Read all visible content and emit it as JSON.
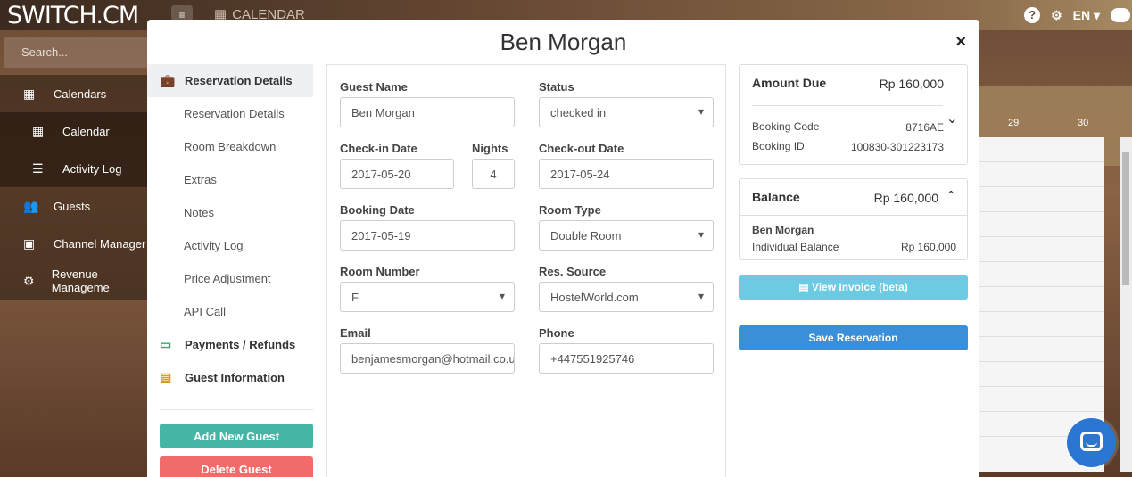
{
  "app": {
    "brand": "SWITCH.CM",
    "menu_icon": "hamburger-icon",
    "top_section": "CALENDAR",
    "language": "EN",
    "help_icon": "question-circle-icon",
    "settings_icon": "gears-icon",
    "chat_icon": "chat-bubble-icon"
  },
  "sidebar": {
    "search_placeholder": "Search...",
    "items": [
      {
        "label": "Calendars",
        "icon": "calendar-icon"
      },
      {
        "label": "Calendar",
        "icon": "calendar-icon"
      },
      {
        "label": "Activity Log",
        "icon": "list-icon"
      },
      {
        "label": "Guests",
        "icon": "users-icon"
      },
      {
        "label": "Channel Manager",
        "icon": "money-icon"
      },
      {
        "label": "Revenue Manageme",
        "icon": "cog-icon"
      }
    ]
  },
  "calendar_bg": {
    "dates": [
      "29",
      "30"
    ]
  },
  "modal": {
    "title": "Ben Morgan",
    "close_label": "×",
    "nav": [
      {
        "label": "Reservation Details",
        "icon": "briefcase-icon"
      },
      {
        "label": "Reservation Details"
      },
      {
        "label": "Room Breakdown"
      },
      {
        "label": "Extras"
      },
      {
        "label": "Notes"
      },
      {
        "label": "Activity Log"
      },
      {
        "label": "Price Adjustment"
      },
      {
        "label": "API Call"
      },
      {
        "label": "Payments / Refunds",
        "icon": "credit-card-icon"
      },
      {
        "label": "Guest Information",
        "icon": "id-card-icon"
      }
    ],
    "add_guest_label": "Add New Guest",
    "delete_guest_label": "Delete Guest"
  },
  "form": {
    "guest_name": {
      "label": "Guest Name",
      "value": "Ben Morgan"
    },
    "status": {
      "label": "Status",
      "value": "checked in"
    },
    "check_in": {
      "label": "Check-in Date",
      "value": "2017-05-20"
    },
    "nights": {
      "label": "Nights",
      "value": "4"
    },
    "check_out": {
      "label": "Check-out Date",
      "value": "2017-05-24"
    },
    "booking_date": {
      "label": "Booking Date",
      "value": "2017-05-19"
    },
    "room_type": {
      "label": "Room Type",
      "value": "Double Room"
    },
    "room_number": {
      "label": "Room Number",
      "value": "F"
    },
    "res_source": {
      "label": "Res. Source",
      "value": "HostelWorld.com"
    },
    "email": {
      "label": "Email",
      "value": "benjamesmorgan@hotmail.co.uk"
    },
    "phone": {
      "label": "Phone",
      "value": "+447551925746"
    }
  },
  "summary": {
    "amount_due_label": "Amount Due",
    "amount_due_value": "Rp 160,000",
    "booking_code_label": "Booking Code",
    "booking_code_value": "8716AE",
    "booking_id_label": "Booking ID",
    "booking_id_value": "100830-301223173",
    "expand_icon": "chevron-down-icon"
  },
  "balance": {
    "label": "Balance",
    "value": "Rp 160,000",
    "collapse_icon": "chevron-up-icon",
    "guest_name": "Ben Morgan",
    "individual_label": "Individual Balance",
    "individual_value": "Rp 160,000"
  },
  "actions": {
    "view_invoice_label": "View Invoice (beta)",
    "save_label": "Save Reservation"
  },
  "colors": {
    "add_guest": "#45b6a5",
    "delete_guest": "#f36a6a",
    "view_invoice": "#6ccbe3",
    "save": "#3b8fd9",
    "chat_widget": "#2a76d2"
  }
}
